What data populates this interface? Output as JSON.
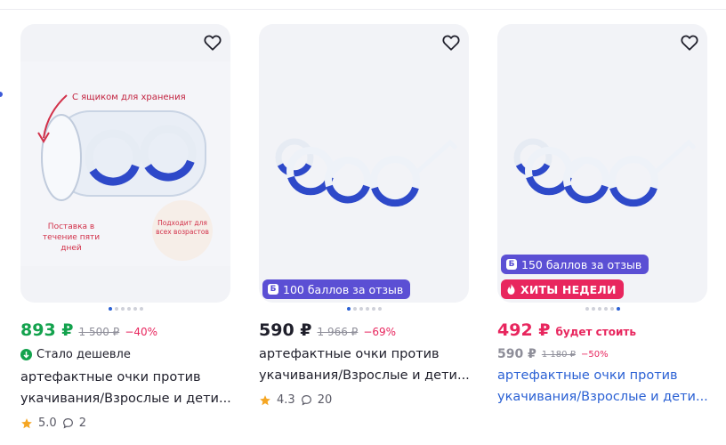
{
  "products": [
    {
      "image": {
        "caption_storage": "С ящиком для хранения",
        "caption_delivery": "Поставка в течение пяти дней",
        "caption_ages": "Подходит для всех возрастов"
      },
      "price": "893 ₽",
      "old_price": "1 500 ₽",
      "discount": "−40%",
      "status_text": "Стало дешевле",
      "title_line1": "артефактные очки против",
      "title_line2": "укачивания/Взрослые и дети...",
      "rating": "5.0",
      "reviews": "2"
    },
    {
      "badge_points": "100 баллов за отзыв",
      "price": "590 ₽",
      "old_price": "1 966 ₽",
      "discount": "−69%",
      "title_line1": "артефактные очки против",
      "title_line2": "укачивания/Взрослые и дети...",
      "rating": "4.3",
      "reviews": "20"
    },
    {
      "badge_points": "150 баллов за отзыв",
      "badge_hits": "ХИТЫ НЕДЕЛИ",
      "price": "492 ₽",
      "price_note": "будет стоить",
      "second_price": "590 ₽",
      "old_price": "1 180 ₽",
      "discount": "−50%",
      "title_line1": "артефактные очки против",
      "title_line2": "укачивания/Взрослые и дети..."
    }
  ],
  "icons": {
    "favorite": "heart-outline-icon",
    "points": "b-coin-icon",
    "hits": "fire-icon",
    "cheaper": "arrow-down-circle-icon",
    "rating": "star-icon",
    "reviews": "speech-bubble-icon"
  },
  "colors": {
    "price_green": "#13a24d",
    "price_red": "#e8265e",
    "points_badge": "#5b4fd4",
    "hits_badge": "#e8265e",
    "link_blue": "#2b61d4",
    "star": "#f5a623"
  }
}
